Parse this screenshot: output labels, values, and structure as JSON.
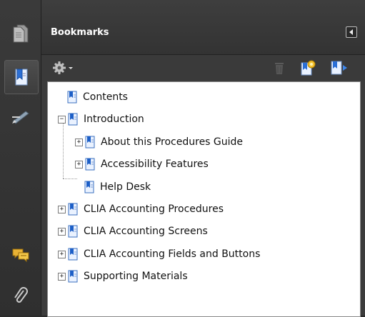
{
  "panel": {
    "title": "Bookmarks",
    "collapse_icon": "triangle-left-icon"
  },
  "rail": {
    "items": [
      {
        "name": "pages-icon"
      },
      {
        "name": "bookmark-icon",
        "active": true
      },
      {
        "name": "signature-icon"
      },
      {
        "name": "comments-icon"
      },
      {
        "name": "attachment-icon"
      }
    ]
  },
  "toolbar": {
    "options_icon": "gear-icon",
    "delete_icon": "trash-icon",
    "new_bookmark_icon": "new-bookmark-icon",
    "expand_icon": "bookmark-arrow-icon"
  },
  "bookmarks": [
    {
      "label": "Contents",
      "level": 0,
      "expander": "none"
    },
    {
      "label": "Introduction",
      "level": 0,
      "expander": "collapse"
    },
    {
      "label": "About this Procedures Guide",
      "level": 1,
      "expander": "expand"
    },
    {
      "label": "Accessibility Features",
      "level": 1,
      "expander": "expand"
    },
    {
      "label": "Help Desk",
      "level": 1,
      "expander": "none"
    },
    {
      "label": "CLIA Accounting Procedures",
      "level": 0,
      "expander": "expand"
    },
    {
      "label": "CLIA Accounting Screens",
      "level": 0,
      "expander": "expand"
    },
    {
      "label": "CLIA Accounting Fields and Buttons",
      "level": 0,
      "expander": "expand"
    },
    {
      "label": "Supporting Materials",
      "level": 0,
      "expander": "expand"
    }
  ],
  "colors": {
    "panel_bg": "#3c3c3c",
    "tree_bg": "#ffffff",
    "bookmark_blue": "#1d5fc7"
  }
}
